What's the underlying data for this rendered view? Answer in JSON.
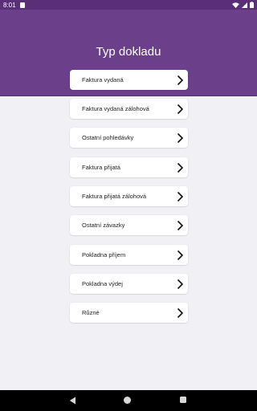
{
  "status_bar": {
    "time": "8:01"
  },
  "header": {
    "title": "Typ dokladu"
  },
  "document_types": [
    {
      "label": "Faktura vydaná"
    },
    {
      "label": "Faktura vydaná zálohová"
    },
    {
      "label": "Ostatní pohledávky"
    },
    {
      "label": "Faktura přijatá"
    },
    {
      "label": "Faktura přijatá zálohová"
    },
    {
      "label": "Ostatní závazky"
    },
    {
      "label": "Pokladna příjem"
    },
    {
      "label": "Pokladna výdej"
    },
    {
      "label": "Různé"
    }
  ],
  "colors": {
    "header": "#6b3f8a",
    "status_bar": "#5a2f78",
    "background": "#f1f0f4"
  },
  "icons": {
    "item_arrow": "chevron-right-icon",
    "nav_back": "back-icon",
    "nav_home": "home-icon",
    "nav_recent": "recent-apps-icon"
  }
}
